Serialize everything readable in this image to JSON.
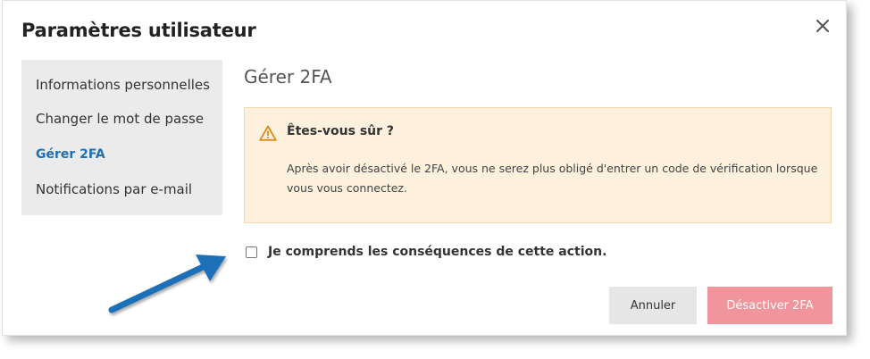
{
  "dialog": {
    "title": "Paramètres utilisateur",
    "close_icon": "close-icon"
  },
  "sidebar": {
    "items": [
      {
        "label": "Informations personnelles",
        "active": false
      },
      {
        "label": "Changer le mot de passe",
        "active": false
      },
      {
        "label": "Gérer 2FA",
        "active": true
      },
      {
        "label": "Notifications par e-mail",
        "active": false
      }
    ]
  },
  "main": {
    "section_title": "Gérer 2FA",
    "warning": {
      "icon": "warning-icon",
      "title": "Êtes-vous sûr ?",
      "text": "Après avoir désactivé le 2FA, vous ne serez plus obligé d'entrer un code de vérification lorsque vous vous connectez."
    },
    "confirm_checkbox": {
      "label": "Je comprends les conséquences de cette action.",
      "checked": false
    },
    "buttons": {
      "cancel": "Annuler",
      "disable": "Désactiver 2FA"
    }
  },
  "colors": {
    "active_link": "#1f6fb2",
    "warning_bg": "#fdf0dc",
    "warning_icon": "#e08a1e",
    "disable_button": "#f0959b",
    "annotation_arrow": "#1a6fb8"
  }
}
